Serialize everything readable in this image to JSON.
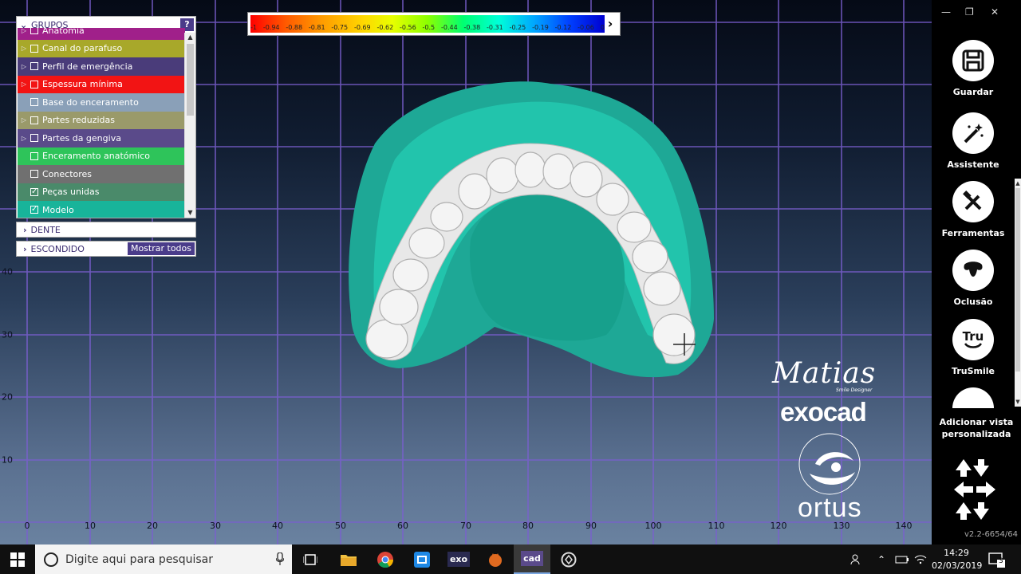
{
  "color_scale": {
    "ticks": [
      "-1",
      "-0.94",
      "-0.88",
      "-0.81",
      "-0.75",
      "-0.69",
      "-0.62",
      "-0.56",
      "-0.5",
      "-0.44",
      "-0.38",
      "-0.31",
      "-0.25",
      "-0.19",
      "-0.12",
      "-0.06",
      "0"
    ]
  },
  "axis": {
    "x_labels": [
      "0",
      "10",
      "20",
      "30",
      "40",
      "50",
      "60",
      "70",
      "80",
      "90",
      "100",
      "110",
      "120",
      "130",
      "140"
    ],
    "y_labels": [
      "40",
      "30",
      "20",
      "10"
    ]
  },
  "groups_panel": {
    "title": "GRUPOS",
    "help": "?",
    "items": [
      {
        "label": "Anatomia",
        "color": "#a0208a",
        "checked": false,
        "expandable": true
      },
      {
        "label": "Canal do parafuso",
        "color": "#a8a82a",
        "checked": false,
        "expandable": true
      },
      {
        "label": "Perfil de emergência",
        "color": "#4a3c7a",
        "checked": false,
        "expandable": true
      },
      {
        "label": "Espessura mínima",
        "color": "#f21414",
        "checked": false,
        "expandable": true
      },
      {
        "label": "Base do enceramento",
        "color": "#8aa0b8",
        "checked": false,
        "expandable": false
      },
      {
        "label": "Partes reduzidas",
        "color": "#9a9a6a",
        "checked": false,
        "expandable": true
      },
      {
        "label": "Partes da gengiva",
        "color": "#5a4a8a",
        "checked": false,
        "expandable": true
      },
      {
        "label": "Enceramento anatómico",
        "color": "#2ec45a",
        "checked": false,
        "expandable": false
      },
      {
        "label": "Conectores",
        "color": "#707070",
        "checked": false,
        "expandable": false
      },
      {
        "label": "Peças unidas",
        "color": "#4a8a6a",
        "checked": true,
        "expandable": false
      },
      {
        "label": "Modelo",
        "color": "#18b49a",
        "checked": true,
        "expandable": false
      }
    ]
  },
  "dente_panel": {
    "title": "DENTE"
  },
  "escondido_panel": {
    "title": "ESCONDIDO",
    "show_all": "Mostrar todos"
  },
  "logos": {
    "signature": "Matias",
    "signature_sub": "Smile Designer",
    "brand": "exocad",
    "partner": "ortus"
  },
  "sidebar": {
    "tools": [
      {
        "label": "Guardar",
        "icon": "save-icon"
      },
      {
        "label": "Assistente",
        "icon": "wizard-icon"
      },
      {
        "label": "Ferramentas",
        "icon": "tools-icon"
      },
      {
        "label": "Oclusão",
        "icon": "occlusion-icon"
      },
      {
        "label": "TruSmile",
        "icon": "trusmile-icon",
        "badge": "Tru"
      }
    ],
    "add_view": "Adicionar vista personalizada",
    "version": "v2.2-6654/64"
  },
  "taskbar": {
    "search_placeholder": "Digite aqui para pesquisar",
    "apps": [
      "task-view",
      "file-explorer",
      "chrome",
      "app-blue",
      "exo",
      "app-orange",
      "cad",
      "app-circle"
    ],
    "exo_label": "exo",
    "cad_label": "cad",
    "time": "14:29",
    "date": "02/03/2019",
    "notifications": "3"
  }
}
